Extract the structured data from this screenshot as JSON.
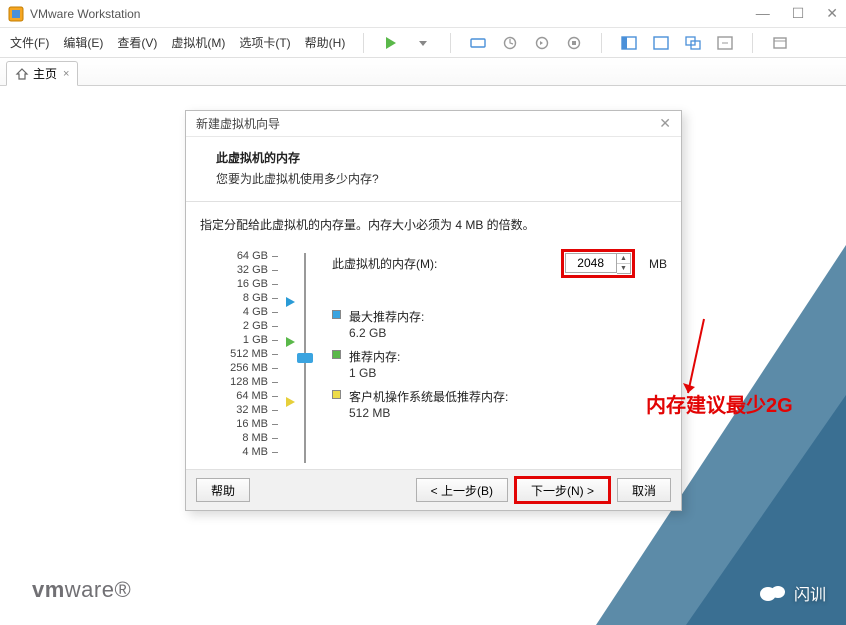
{
  "window": {
    "title": "VMware Workstation"
  },
  "menu": {
    "file": "文件(F)",
    "edit": "编辑(E)",
    "view": "查看(V)",
    "vm": "虚拟机(M)",
    "tabs": "选项卡(T)",
    "help": "帮助(H)"
  },
  "tab": {
    "home": "主页",
    "close": "×"
  },
  "logo": {
    "brand_prefix": "vm",
    "brand_suffix": "ware"
  },
  "watermark": {
    "text": "闪训"
  },
  "dialog": {
    "title": "新建虚拟机向导",
    "heading": "此虚拟机的内存",
    "subheading": "您要为此虚拟机使用多少内存?",
    "description": "指定分配给此虚拟机的内存量。内存大小必须为 4 MB 的倍数。",
    "memory_label": "此虚拟机的内存(M):",
    "memory_value": "2048",
    "memory_unit": "MB",
    "scale": [
      "64 GB",
      "32 GB",
      "16 GB",
      "8 GB",
      "4 GB",
      "2 GB",
      "1 GB",
      "512 MB",
      "256 MB",
      "128 MB",
      "64 MB",
      "32 MB",
      "16 MB",
      "8 MB",
      "4 MB"
    ],
    "rec_max_label": "最大推荐内存:",
    "rec_max_value": "6.2 GB",
    "rec_label": "推荐内存:",
    "rec_value": "1 GB",
    "rec_min_label": "客户机操作系统最低推荐内存:",
    "rec_min_value": "512 MB",
    "annotation": "内存建议最少2G",
    "btn_help": "帮助",
    "btn_back": "< 上一步(B)",
    "btn_next": "下一步(N) >",
    "btn_cancel": "取消"
  }
}
